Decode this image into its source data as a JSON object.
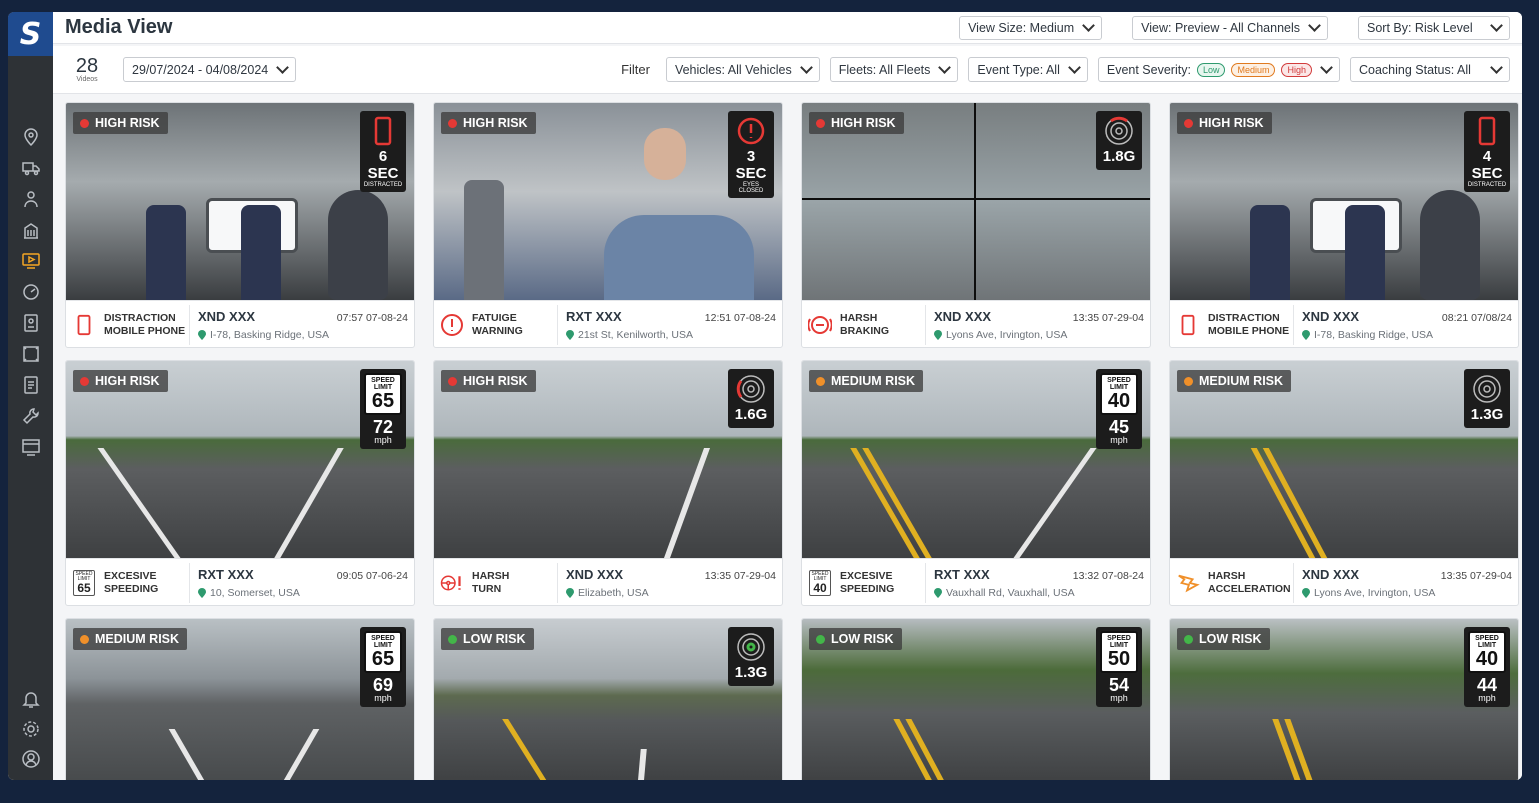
{
  "app": {
    "logo_letter": "S"
  },
  "header": {
    "title": "Media View",
    "view_size": "View Size: Medium",
    "view": "View: Preview - All Channels",
    "sort_by": "Sort By: Risk Level"
  },
  "filters": {
    "count": "28",
    "count_label": "Videos",
    "date_range": "29/07/2024 - 04/08/2024",
    "filter_label": "Filter",
    "vehicles": "Vehicles: All Vehicles",
    "fleets": "Fleets: All Fleets",
    "event_type": "Event Type: All",
    "event_severity_label": "Event Severity:",
    "severity_pills": [
      "Low",
      "Medium",
      "High"
    ],
    "coaching_status": "Coaching Status: All"
  },
  "cards": [
    {
      "risk": "HIGH RISK",
      "badge_big": "6 SEC",
      "badge_small": "DISTRACTED",
      "event": [
        "DISTRACTION",
        "MOBILE PHONE"
      ],
      "vehicle": "XND XXX",
      "time": "07:57 07-08-24",
      "location": "I-78, Basking Ridge, USA"
    },
    {
      "risk": "HIGH RISK",
      "badge_big": "3 SEC",
      "badge_small": "EYES CLOSED",
      "event": [
        "FATUIGE",
        "WARNING"
      ],
      "vehicle": "RXT XXX",
      "time": "12:51 07-08-24",
      "location": "21st St, Kenilworth, USA"
    },
    {
      "risk": "HIGH RISK",
      "badge_big": "1.8G",
      "event": [
        "HARSH",
        "BRAKING"
      ],
      "vehicle": "XND XXX",
      "time": "13:35 07-29-04",
      "location": "Lyons Ave, Irvington, USA"
    },
    {
      "risk": "HIGH RISK",
      "badge_big": "4 SEC",
      "badge_small": "DISTRACTED",
      "event": [
        "DISTRACTION",
        "MOBILE PHONE"
      ],
      "vehicle": "XND XXX",
      "time": "08:21 07/08/24",
      "location": "I-78, Basking Ridge, USA"
    },
    {
      "risk": "HIGH RISK",
      "limit_label": "SPEED LIMIT",
      "limit": "65",
      "speed": "72",
      "unit": "mph",
      "event": [
        "EXCESIVE",
        "SPEEDING"
      ],
      "vehicle": "RXT XXX",
      "time": "09:05 07-06-24",
      "location": "10, Somerset, USA"
    },
    {
      "risk": "HIGH RISK",
      "badge_big": "1.6G",
      "event": [
        "HARSH",
        "TURN"
      ],
      "vehicle": "XND XXX",
      "time": "13:35 07-29-04",
      "location": "Elizabeth, USA"
    },
    {
      "risk": "MEDIUM RISK",
      "limit_label": "SPEED LIMIT",
      "limit": "40",
      "speed": "45",
      "unit": "mph",
      "event": [
        "EXCESIVE",
        "SPEEDING"
      ],
      "vehicle": "RXT XXX",
      "time": "13:32 07-08-24",
      "location": "Vauxhall Rd, Vauxhall, USA"
    },
    {
      "risk": "MEDIUM RISK",
      "badge_big": "1.3G",
      "event": [
        "HARSH",
        "ACCELERATION"
      ],
      "vehicle": "XND XXX",
      "time": "13:35 07-29-04",
      "location": "Lyons Ave, Irvington, USA"
    },
    {
      "risk": "MEDIUM RISK",
      "limit_label": "SPEED LIMIT",
      "limit": "65",
      "speed": "69",
      "unit": "mph"
    },
    {
      "risk": "LOW RISK",
      "badge_big": "1.3G"
    },
    {
      "risk": "LOW RISK",
      "limit_label": "SPEED LIMIT",
      "limit": "50",
      "speed": "54",
      "unit": "mph"
    },
    {
      "risk": "LOW RISK",
      "limit_label": "SPEED LIMIT",
      "limit": "40",
      "speed": "44",
      "unit": "mph"
    }
  ],
  "colors": {
    "high": "#e53935",
    "medium": "#f0902a",
    "low": "#43b649",
    "sidebar": "#2e3236",
    "logo_bg": "#1f4b8f"
  }
}
